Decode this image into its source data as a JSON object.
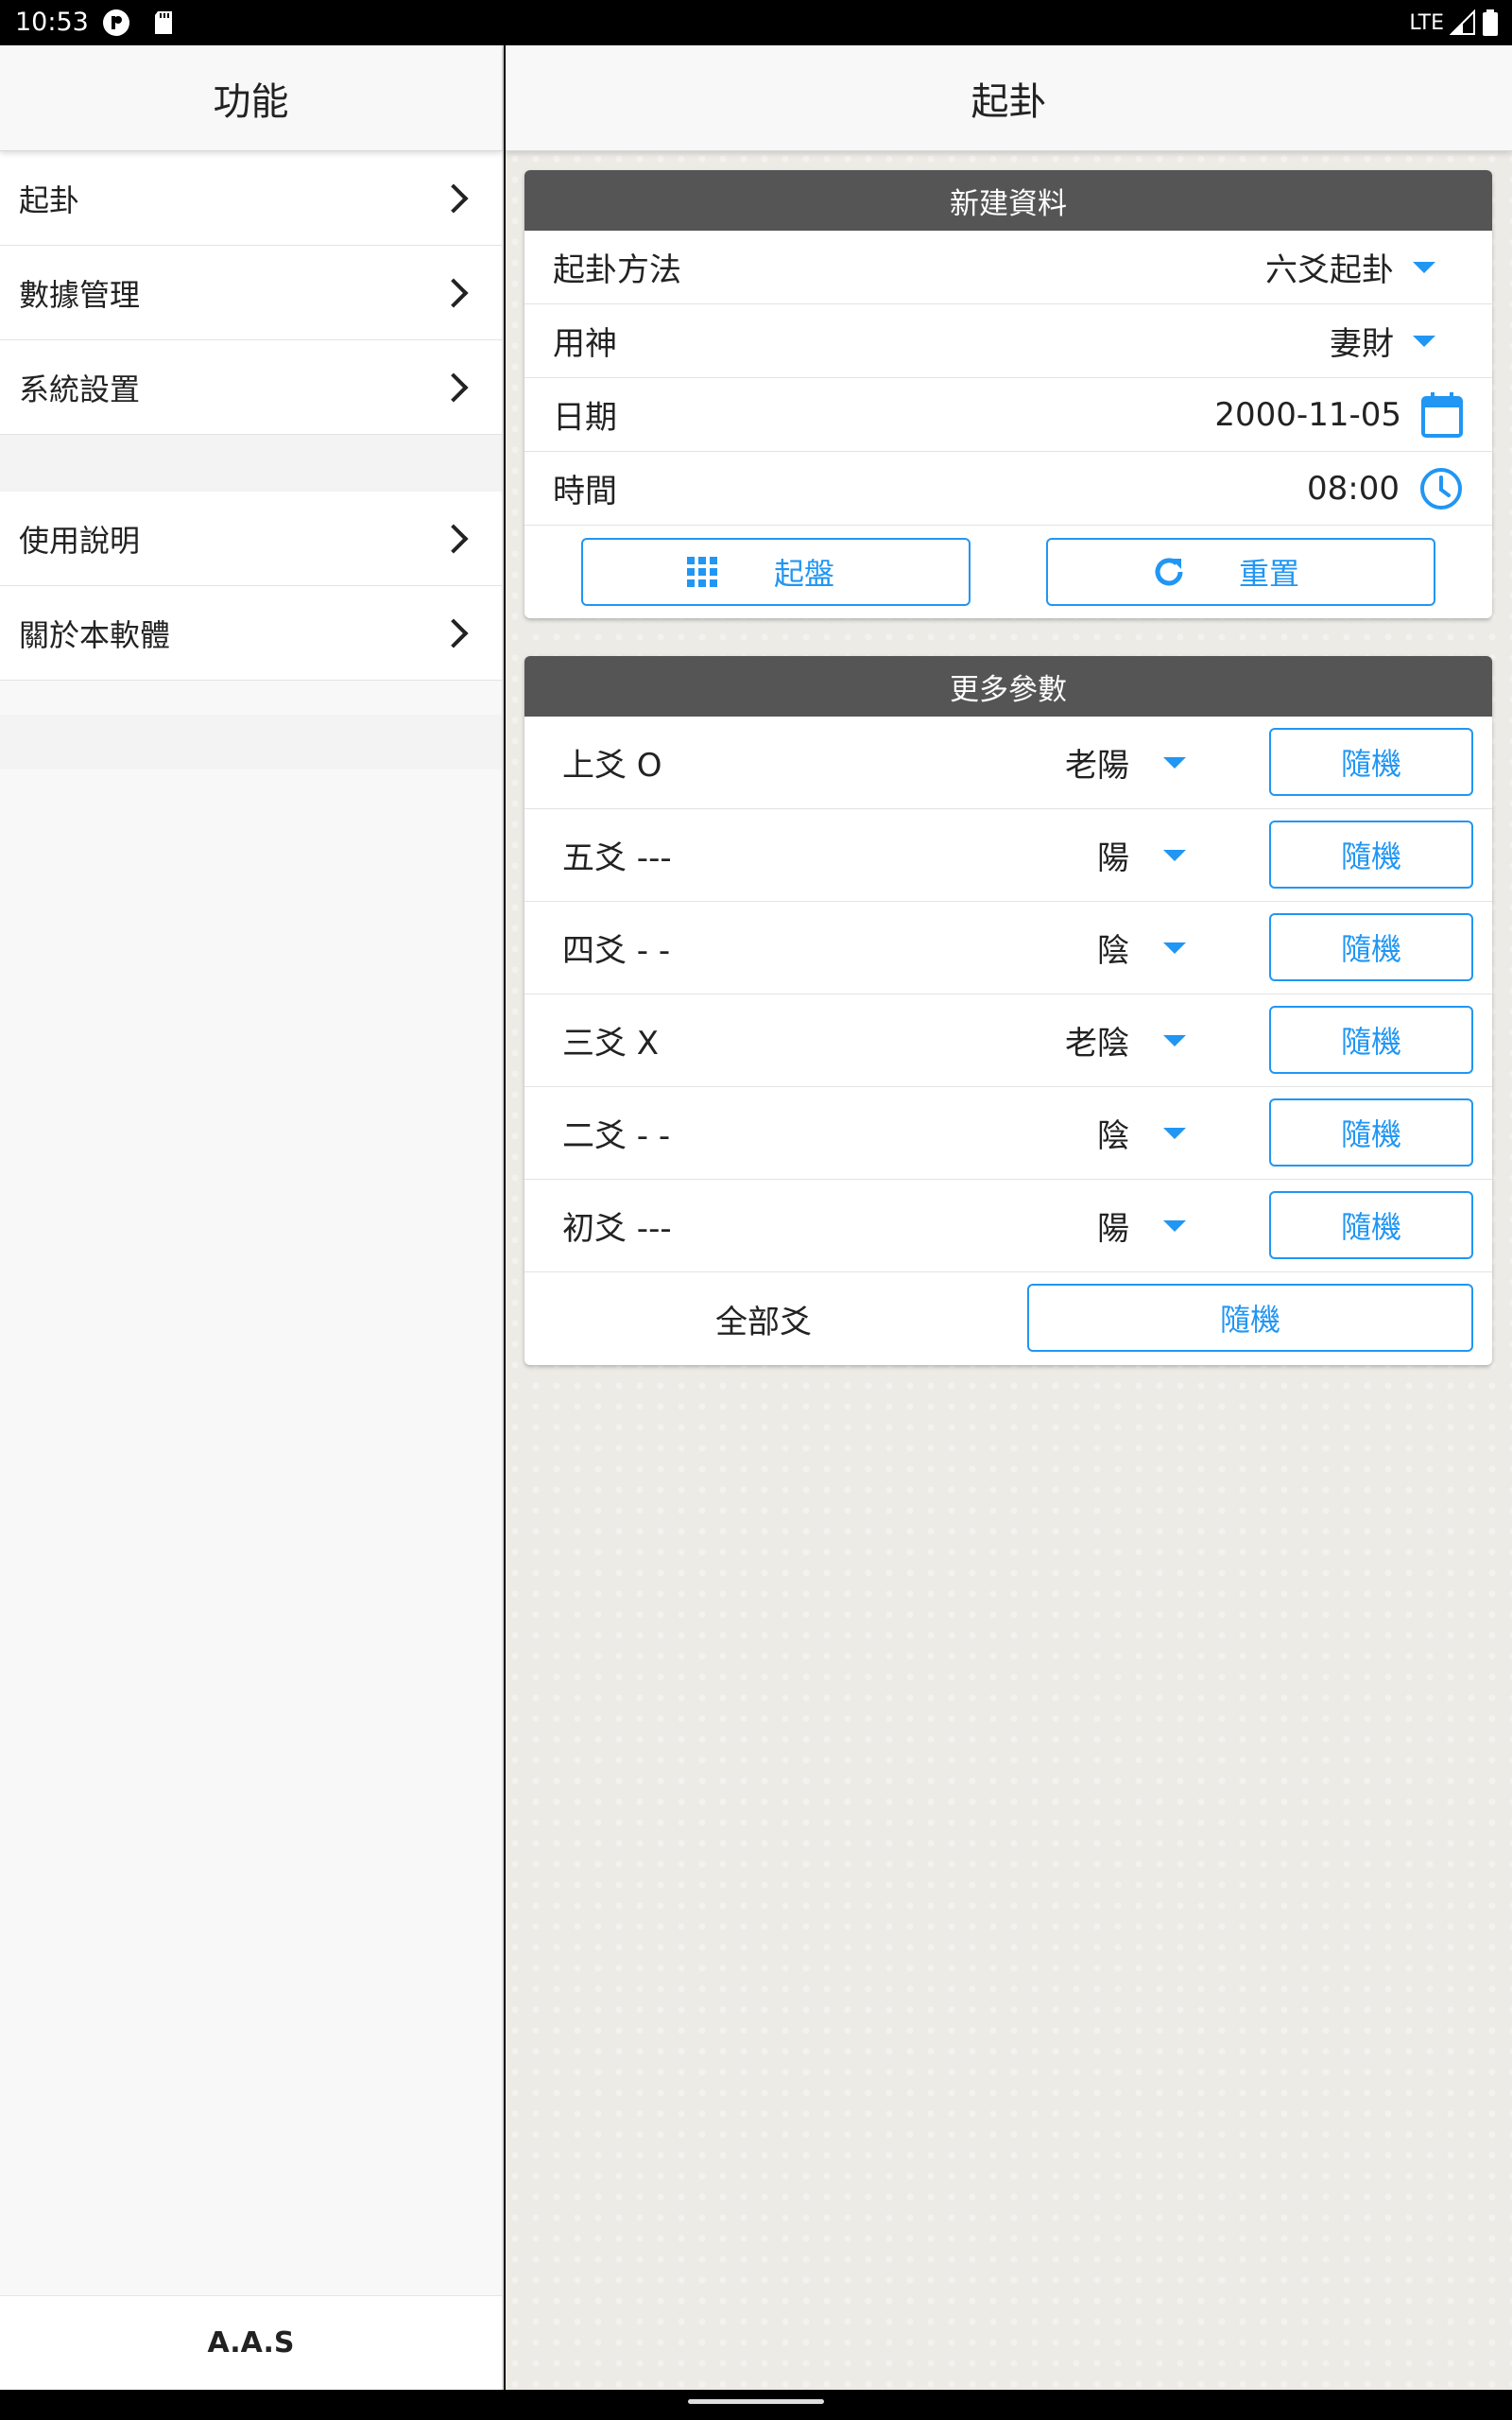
{
  "status_bar": {
    "time": "10:53",
    "network": "LTE",
    "icons": [
      "p-circle-icon",
      "sd-card-icon",
      "signal-icon",
      "battery-icon"
    ]
  },
  "sidebar": {
    "title": "功能",
    "items_group1": [
      {
        "label": "起卦"
      },
      {
        "label": "數據管理"
      },
      {
        "label": "系統設置"
      }
    ],
    "items_group2": [
      {
        "label": "使用說明"
      },
      {
        "label": "關於本軟體"
      }
    ],
    "footer": "A.A.S"
  },
  "main": {
    "title": "起卦",
    "new_card": {
      "title": "新建資料",
      "method_label": "起卦方法",
      "method_value": "六爻起卦",
      "yongshen_label": "用神",
      "yongshen_value": "妻財",
      "date_label": "日期",
      "date_value": "2000-11-05",
      "time_label": "時間",
      "time_value": "08:00",
      "start_button": "起盤",
      "reset_button": "重置"
    },
    "more_card": {
      "title": "更多參數",
      "rows": [
        {
          "label": "上爻 O",
          "value": "老陽",
          "button": "隨機"
        },
        {
          "label": "五爻 ---",
          "value": "陽",
          "button": "隨機"
        },
        {
          "label": "四爻 - -",
          "value": "陰",
          "button": "隨機"
        },
        {
          "label": "三爻 X",
          "value": "老陰",
          "button": "隨機"
        },
        {
          "label": "二爻 - -",
          "value": "陰",
          "button": "隨機"
        },
        {
          "label": "初爻 ---",
          "value": "陽",
          "button": "隨機"
        }
      ],
      "all_label": "全部爻",
      "all_button": "隨機"
    }
  },
  "colors": {
    "accent": "#2196f3",
    "card_header": "#555555",
    "background": "#ecebe6"
  }
}
